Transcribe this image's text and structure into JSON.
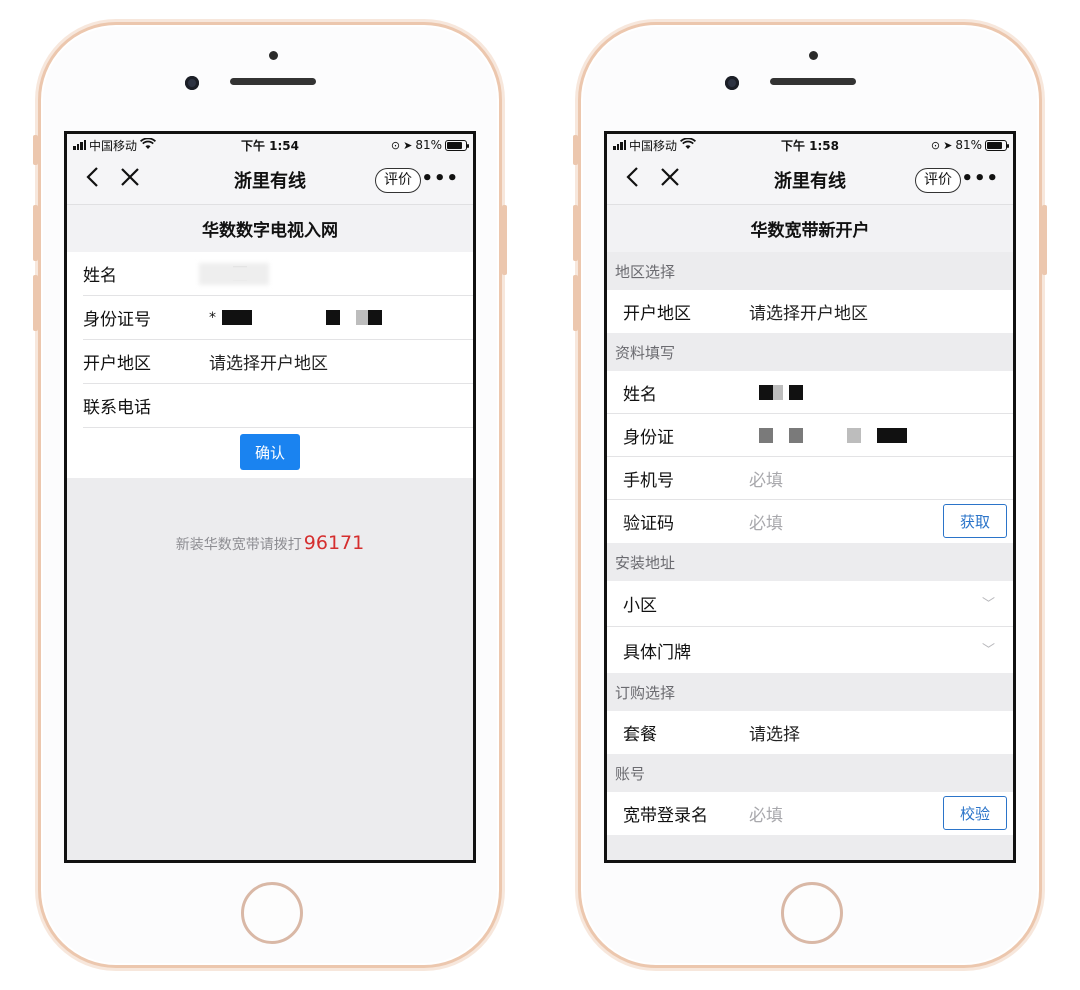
{
  "left": {
    "status": {
      "carrier": "中国移动",
      "time": "下午 1:54",
      "battery": "81%",
      "battery_level": 0.81
    },
    "nav": {
      "back_icon": "chevron-left-icon",
      "close_icon": "close-icon",
      "title": "浙里有线",
      "rate_label": "评价",
      "more_icon": "more-icon"
    },
    "page_title": "华数数字电视入网",
    "fields": [
      {
        "label": "姓名",
        "value": ""
      },
      {
        "label": "身份证号",
        "value": "*"
      },
      {
        "label": "开户地区",
        "value": "请选择开户地区"
      },
      {
        "label": "联系电话",
        "value": ""
      }
    ],
    "confirm_label": "确认",
    "hint_text": "新装华数宽带请拨打",
    "hint_number": "96171"
  },
  "right": {
    "status": {
      "carrier": "中国移动",
      "time": "下午 1:58",
      "battery": "81%",
      "battery_level": 0.81
    },
    "nav": {
      "title": "浙里有线",
      "rate_label": "评价"
    },
    "page_title": "华数宽带新开户",
    "sections": {
      "region": {
        "title": "地区选择",
        "label": "开户地区",
        "value": "请选择开户地区"
      },
      "info": {
        "title": "资料填写",
        "name_label": "姓名",
        "id_label": "身份证",
        "phone_label": "手机号",
        "phone_placeholder": "必填",
        "code_label": "验证码",
        "code_placeholder": "必填",
        "code_button": "获取"
      },
      "address": {
        "title": "安装地址",
        "community_label": "小区",
        "door_label": "具体门牌"
      },
      "order": {
        "title": "订购选择",
        "package_label": "套餐",
        "package_value": "请选择"
      },
      "account": {
        "title": "账号",
        "login_label": "宽带登录名",
        "login_placeholder": "必填",
        "verify_button": "校验"
      }
    }
  },
  "colors": {
    "accent": "#1a83f0",
    "hotline": "#d52e2e",
    "frame": "#ecc7ae"
  }
}
